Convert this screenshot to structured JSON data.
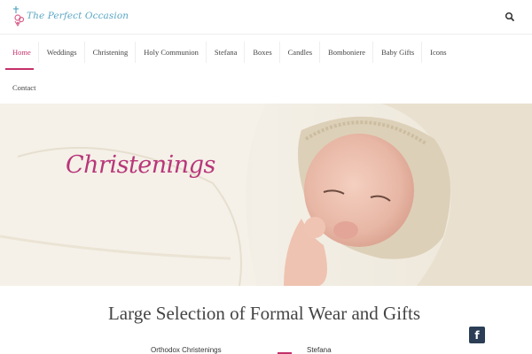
{
  "header": {
    "logo_text": "The Perfect Occasion",
    "logo_icon": "cross-bow-icon",
    "search_icon": "search-icon"
  },
  "nav": {
    "row1": [
      {
        "label": "Home",
        "active": true
      },
      {
        "label": "Weddings",
        "active": false
      },
      {
        "label": "Christening",
        "active": false
      },
      {
        "label": "Holy Communion",
        "active": false
      },
      {
        "label": "Stefana",
        "active": false
      },
      {
        "label": "Boxes",
        "active": false
      },
      {
        "label": "Candles",
        "active": false
      },
      {
        "label": "Bomboniere",
        "active": false
      },
      {
        "label": "Baby Gifts",
        "active": false
      },
      {
        "label": "Icons",
        "active": false
      }
    ],
    "row2": [
      {
        "label": "Contact",
        "active": false
      }
    ]
  },
  "hero": {
    "caption": "Christenings"
  },
  "content": {
    "title": "Large Selection of Formal Wear and Gifts",
    "left_subtitle": "Orthodox Christenings",
    "right_subtitle": "Stefana"
  },
  "social": {
    "facebook_label": "f"
  },
  "colors": {
    "accent": "#c4306a",
    "logo": "#5aa6c4",
    "social": "#2b3e56"
  }
}
